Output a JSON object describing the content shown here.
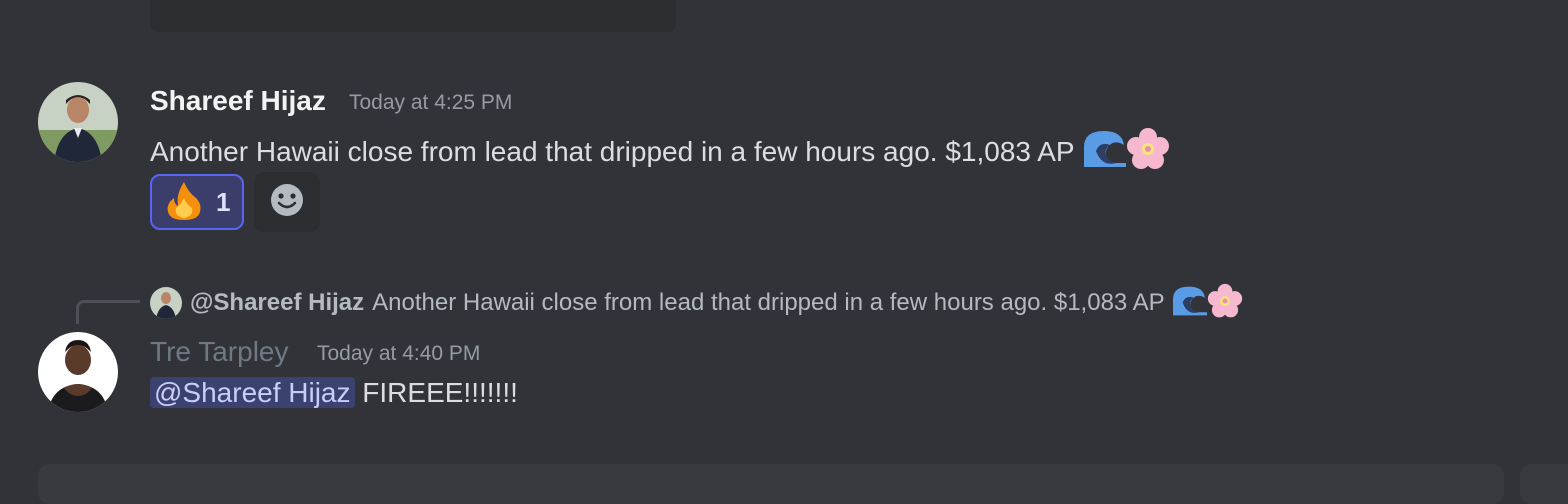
{
  "messages": [
    {
      "author": "Shareef Hijaz",
      "timestamp": "Today at 4:25 PM",
      "content": "Another Hawaii close from lead that dripped in a few hours ago. $1,083 AP",
      "content_emojis": [
        "water-wave",
        "cherry-blossom"
      ],
      "reactions": [
        {
          "emoji": "fire",
          "count": "1",
          "reacted_by_me": true
        }
      ]
    },
    {
      "author": "Tre Tarpley",
      "timestamp": "Today at 4:40 PM",
      "reply": {
        "author": "@Shareef Hijaz",
        "text": "Another Hawaii close from lead that dripped in a few hours ago. $1,083 AP",
        "content_emojis": [
          "water-wave",
          "cherry-blossom"
        ]
      },
      "mention": "@Shareef Hijaz",
      "content": "FIREEE!!!!!!!"
    }
  ],
  "colors": {
    "background": "#313338",
    "mention_bg": "#3c4270",
    "reaction_border": "#5865f2"
  }
}
